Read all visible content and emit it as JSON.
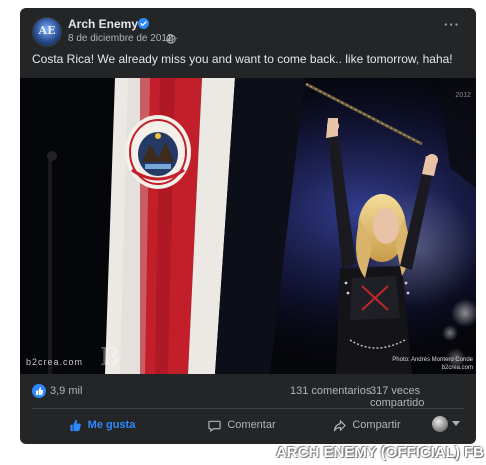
{
  "post": {
    "page_name": "Arch Enemy",
    "avatar_letters": "AE",
    "date": "8 de diciembre de 2012",
    "date_separator": "·",
    "text": "Costa Rica! We already miss you and want to come back.. like tomorrow, haha!",
    "more_label": "···"
  },
  "photo": {
    "year": "2012",
    "watermark_left": "b2crea.com",
    "watermark_letter": "B",
    "credit": "Photo: Andrés Montero Conde",
    "site": "b2crea.com"
  },
  "stats": {
    "likes": "3,9 mil",
    "comments": "131 comentarios",
    "shares": "317 veces compartido"
  },
  "actions": {
    "like_label": "Me gusta",
    "comment_label": "Comentar",
    "share_label": "Compartir"
  },
  "footer": {
    "caption": "ARCH ENEMY (OFFICIAL) FB"
  },
  "colors": {
    "card_bg": "#242526",
    "accent_blue": "#2d88ff",
    "text_primary": "#e4e6eb",
    "text_secondary": "#b0b3b8",
    "flag_red": "#c21f2b"
  }
}
